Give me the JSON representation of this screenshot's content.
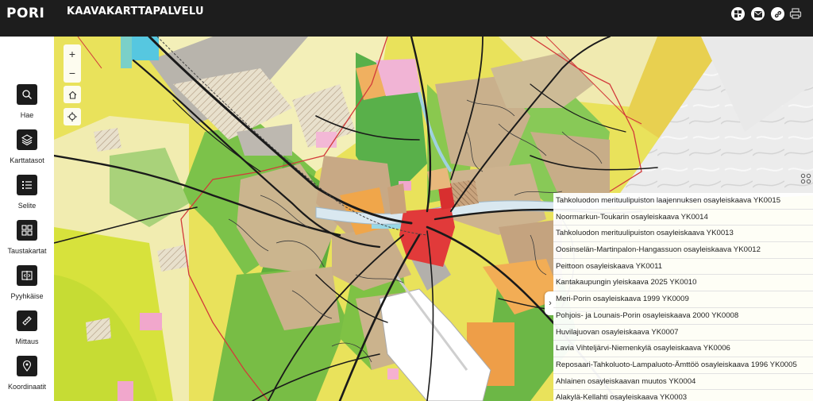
{
  "header": {
    "logo_text": "PORI",
    "title": "KAAVAKARTTAPALVELU",
    "icons": [
      "qr-code-icon",
      "mail-icon",
      "link-icon",
      "print-icon"
    ]
  },
  "sidebar": {
    "tools": [
      {
        "label": "Hae",
        "icon": "search-icon"
      },
      {
        "label": "Karttatasot",
        "icon": "layers-icon"
      },
      {
        "label": "Selite",
        "icon": "legend-list-icon"
      },
      {
        "label": "Taustakartat",
        "icon": "background-maps-icon"
      },
      {
        "label": "Pyyhkäise",
        "icon": "swipe-icon"
      },
      {
        "label": "Mittaus",
        "icon": "ruler-icon"
      },
      {
        "label": "Koordinaatit",
        "icon": "location-pin-icon"
      }
    ]
  },
  "map_controls": {
    "zoom_in": "+",
    "zoom_out": "−"
  },
  "layer_list": {
    "items": [
      "Tahkoluodon merituulipuiston laajennuksen osayleiskaava  YK0015",
      "Noormarkun-Toukarin osayleiskaava YK0014",
      "Tahkoluodon merituulipuiston osayleiskaava YK0013",
      "Oosinselän-Martinpalon-Hangassuon osayleiskaava YK0012",
      "Peittoon osayleiskaava YK0011",
      "Kantakaupungin yleiskaava 2025 YK0010",
      "Meri-Porin osayleiskaava 1999 YK0009",
      "Pohjois- ja Lounais-Porin osayleiskaava 2000 YK0008",
      "Huvilajuovan osayleiskaava YK0007",
      "Lavia Vihteljärvi-Niemenkylä osayleiskaava YK0006",
      "Reposaari-Tahkoluoto-Lampaluoto-Ämttöö osayleiskaava 1996 YK0005",
      "Ahlainen osayleiskaavan muutos YK0004",
      "Alakylä-Kellahti osayleiskaava YK0003"
    ],
    "collapse_glyph": "›"
  }
}
